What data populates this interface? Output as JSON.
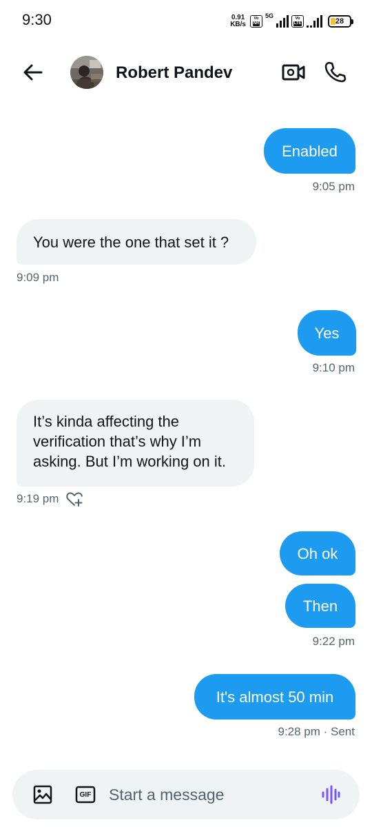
{
  "status_bar": {
    "time": "9:30",
    "net_speed_value": "0.91",
    "net_speed_unit": "KB/s",
    "volte1_top": "Vo",
    "volte1_bottom": "NR",
    "net_type": "5G",
    "volte2_top": "Vo",
    "volte2_bottom": "LTE",
    "battery_level": "28",
    "battery_fraction": 0.28
  },
  "header": {
    "contact_name": "Robert Pandev",
    "back_icon": "arrow-left-icon",
    "video_icon": "video-camera-icon",
    "call_icon": "phone-icon"
  },
  "messages": [
    {
      "direction": "sent",
      "text": "Enabled",
      "time": "9:05 pm"
    },
    {
      "direction": "received",
      "text": "You were the one that set it ?",
      "time": "9:09 pm"
    },
    {
      "direction": "sent",
      "text": "Yes",
      "time": "9:10 pm"
    },
    {
      "direction": "received",
      "text": "It’s kinda affecting the verification that’s why I’m asking. But I’m working on it.",
      "time": "9:19 pm"
    },
    {
      "direction": "sent",
      "text": "Oh ok"
    },
    {
      "direction": "sent",
      "text": "Then",
      "time": "9:22 pm"
    },
    {
      "direction": "sent",
      "text": "It's almost 50 min",
      "time": "9:28 pm · Sent"
    }
  ],
  "composer": {
    "placeholder": "Start a message",
    "gif_label": "GIF",
    "media_icon": "image-icon",
    "voice_icon": "voice-waveform-icon"
  },
  "colors": {
    "sent_bubble": "#1d9bf0",
    "received_bubble": "#eff3f4",
    "timestamp": "#536471",
    "voice_accent": "#7856ff"
  }
}
